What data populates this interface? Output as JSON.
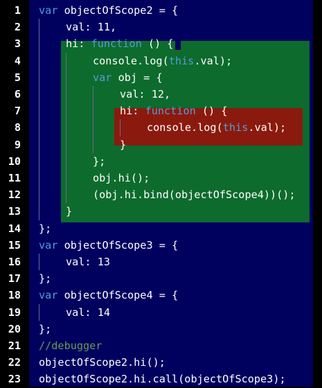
{
  "lines": [
    {
      "n": "1",
      "indent": 0,
      "tokens": [
        [
          "kw",
          "var"
        ],
        [
          "id",
          " objectOfScope2 = {"
        ]
      ]
    },
    {
      "n": "2",
      "indent": 1,
      "tokens": [
        [
          "id",
          "val: 11,"
        ]
      ]
    },
    {
      "n": "3",
      "indent": 1,
      "tokens": [
        [
          "id",
          "hi: "
        ],
        [
          "kw",
          "function"
        ],
        [
          "id",
          " () {"
        ]
      ]
    },
    {
      "n": "4",
      "indent": 2,
      "tokens": [
        [
          "id",
          "console.log("
        ],
        [
          "kw",
          "this"
        ],
        [
          "id",
          ".val);"
        ]
      ]
    },
    {
      "n": "5",
      "indent": 2,
      "tokens": [
        [
          "kw",
          "var"
        ],
        [
          "id",
          " obj = {"
        ]
      ]
    },
    {
      "n": "6",
      "indent": 3,
      "tokens": [
        [
          "id",
          "val: 12,"
        ]
      ]
    },
    {
      "n": "7",
      "indent": 3,
      "tokens": [
        [
          "id",
          "hi: "
        ],
        [
          "kw",
          "function"
        ],
        [
          "id",
          " () {"
        ]
      ]
    },
    {
      "n": "8",
      "indent": 4,
      "tokens": [
        [
          "id",
          "console.log("
        ],
        [
          "kw",
          "this"
        ],
        [
          "id",
          ".val);"
        ]
      ]
    },
    {
      "n": "9",
      "indent": 3,
      "tokens": [
        [
          "id",
          "}"
        ]
      ]
    },
    {
      "n": "10",
      "indent": 2,
      "tokens": [
        [
          "id",
          "};"
        ]
      ]
    },
    {
      "n": "11",
      "indent": 2,
      "tokens": [
        [
          "id",
          "obj.hi();"
        ]
      ]
    },
    {
      "n": "12",
      "indent": 2,
      "tokens": [
        [
          "id",
          "(obj.hi.bind(objectOfScope4))();"
        ]
      ]
    },
    {
      "n": "13",
      "indent": 1,
      "tokens": [
        [
          "id",
          "}"
        ]
      ]
    },
    {
      "n": "14",
      "indent": 0,
      "tokens": [
        [
          "id",
          "};"
        ]
      ]
    },
    {
      "n": "15",
      "indent": 0,
      "tokens": [
        [
          "kw",
          "var"
        ],
        [
          "id",
          " objectOfScope3 = {"
        ]
      ]
    },
    {
      "n": "16",
      "indent": 1,
      "tokens": [
        [
          "id",
          "val: 13"
        ]
      ]
    },
    {
      "n": "17",
      "indent": 0,
      "tokens": [
        [
          "id",
          "};"
        ]
      ]
    },
    {
      "n": "18",
      "indent": 0,
      "tokens": [
        [
          "kw",
          "var"
        ],
        [
          "id",
          " objectOfScope4 = {"
        ]
      ]
    },
    {
      "n": "19",
      "indent": 1,
      "tokens": [
        [
          "id",
          "val: 14"
        ]
      ]
    },
    {
      "n": "20",
      "indent": 0,
      "tokens": [
        [
          "id",
          "};"
        ]
      ]
    },
    {
      "n": "21",
      "indent": 0,
      "tokens": [
        [
          "cm",
          "//debugger"
        ]
      ]
    },
    {
      "n": "22",
      "indent": 0,
      "tokens": [
        [
          "id",
          "objectOfScope2.hi();"
        ]
      ]
    },
    {
      "n": "23",
      "indent": 0,
      "tokens": [
        [
          "id",
          "objectOfScope2.hi.call(objectOfScope3);"
        ]
      ]
    }
  ],
  "colors": {
    "code_background": "#00005f",
    "outer_scope_highlight": "#0d6b2e",
    "inner_scope_highlight": "#8b1a0e",
    "keyword": "#569cd6",
    "comment": "#6a9955",
    "text": "#ffffff"
  }
}
